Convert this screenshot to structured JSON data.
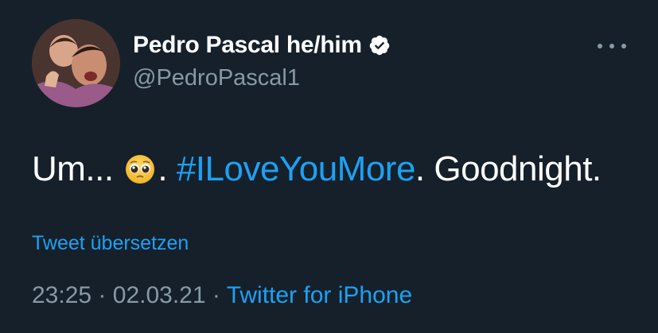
{
  "tweet": {
    "author": {
      "display_name": "Pedro Pascal he/him",
      "handle": "@PedroPascal1",
      "verified": true,
      "avatar_icon": "profile-photo"
    },
    "text": {
      "prefix": "Um...",
      "emoji": "pleading-face-emoji",
      "separator": ".",
      "hashtag": "#ILoveYouMore",
      "suffix": ". Goodnight."
    },
    "translate_label": "Tweet übersetzen",
    "time": "23:25",
    "dot1": "·",
    "date": "02.03.21",
    "dot2": "·",
    "source": "Twitter for iPhone",
    "more_icon": "more-horizontal-icon"
  },
  "colors": {
    "background": "#15202b",
    "text": "#ffffff",
    "secondary": "#8899a6",
    "accent": "#1da1f2"
  }
}
